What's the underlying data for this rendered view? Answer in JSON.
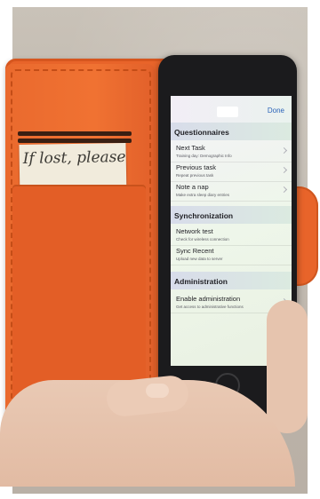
{
  "note": {
    "handwriting": "If lost, please"
  },
  "app": {
    "nav": {
      "done_label": "Done"
    },
    "sections": [
      {
        "label": "Questionnaires",
        "rows": [
          {
            "title": "Next Task",
            "subtitle": "Training day: Demographic Info"
          },
          {
            "title": "Previous task",
            "subtitle": "Repeat previous task"
          },
          {
            "title": "Note a nap",
            "subtitle": "Make extra sleep diary entries"
          }
        ]
      },
      {
        "label": "Synchronization",
        "rows": [
          {
            "title": "Network test",
            "subtitle": "Check for wireless connection"
          },
          {
            "title": "Sync Recent",
            "subtitle": "Upload new data to server"
          }
        ]
      },
      {
        "label": "Administration",
        "rows": [
          {
            "title": "Enable administration",
            "subtitle": "Get access to administrative functions"
          }
        ]
      }
    ]
  },
  "colors": {
    "wallet": "#e8642a",
    "phone": "#1b1b1d",
    "link": "#2a63b8"
  }
}
